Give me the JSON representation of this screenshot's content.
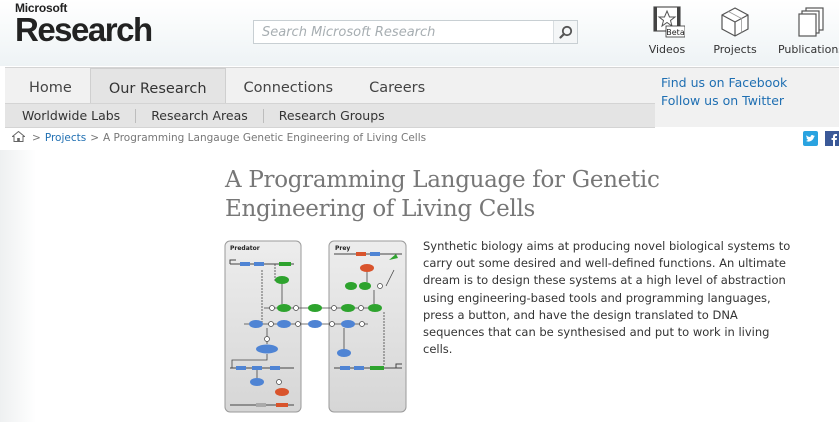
{
  "header": {
    "logo_top": "Microsoft",
    "logo_main": "Research",
    "search_placeholder": "Search Microsoft Research",
    "quick_links": [
      {
        "label": "Videos",
        "badge": "Beta",
        "icon": "film-star-icon"
      },
      {
        "label": "Projects",
        "icon": "cube-icon"
      },
      {
        "label": "Publications",
        "icon": "documents-icon"
      }
    ]
  },
  "nav": {
    "tabs": [
      "Home",
      "Our Research",
      "Connections",
      "Careers"
    ],
    "active_tab": "Our Research",
    "subnav": [
      "Worldwide Labs",
      "Research Areas",
      "Research Groups"
    ],
    "social": [
      "Find us on Facebook",
      "Follow us on Twitter"
    ]
  },
  "breadcrumb": {
    "items": [
      "Projects",
      "A Programming Langauge Genetic Engineering of Living Cells"
    ],
    "separator": ">"
  },
  "main": {
    "title": "A Programming Language for Genetic Engineering of Living Cells",
    "figure": {
      "panel_left": "Predator",
      "panel_right": "Prey"
    },
    "description": "Synthetic biology aims at producing novel biological systems to carry out some desired and well-defined functions. An ultimate dream is to design these systems at a high level of abstraction using engineering-based tools and programming languages, press a button, and have the design translated to DNA sequences that can be synthesised and put to work in living cells."
  },
  "colors": {
    "link": "#1f6fb2",
    "title": "#777777",
    "nav_bg": "#f1f1f1",
    "active_tab_bg": "#e4e4e4",
    "twitter": "#2aa3e0",
    "facebook": "#3b5998",
    "green_node": "#2ea32e",
    "blue_node": "#4f84d4",
    "red_node": "#d9542c"
  }
}
